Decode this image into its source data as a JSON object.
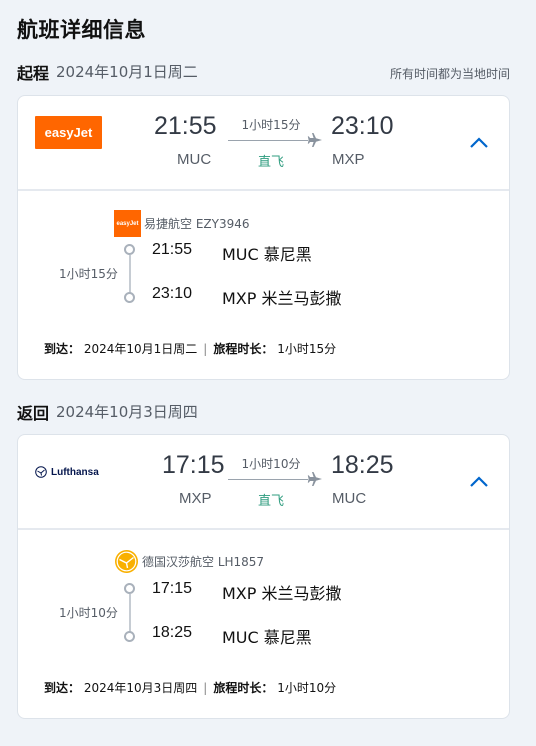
{
  "page_title": "航班详细信息",
  "outbound": {
    "kind": "起程",
    "date": "2024年10月1日周二",
    "timezone_note": "所有时间都为当地时间",
    "logo_text": "easyJet",
    "dep_time": "21:55",
    "arr_time": "23:10",
    "dep_code": "MUC",
    "arr_code": "MXP",
    "duration": "1小时15分",
    "direct": "直飞",
    "airline_flight": "易捷航空 EZY3946",
    "mini_logo": "easyJet",
    "tl_duration": "1小时15分",
    "tl_dep_time": "21:55",
    "tl_dep_place": "MUC 慕尼黑",
    "tl_arr_time": "23:10",
    "tl_arr_place": "MXP 米兰马彭撒",
    "arrive_label": "到达：",
    "arrive_date": "2024年10月1日周二",
    "total_label": "旅程时长：",
    "total_duration": "1小时15分"
  },
  "return": {
    "kind": "返回",
    "date": "2024年10月3日周四",
    "logo_text": "Lufthansa",
    "dep_time": "17:15",
    "arr_time": "18:25",
    "dep_code": "MXP",
    "arr_code": "MUC",
    "duration": "1小时10分",
    "direct": "直飞",
    "airline_flight": "德国汉莎航空 LH1857",
    "tl_duration": "1小时10分",
    "tl_dep_time": "17:15",
    "tl_dep_place": "MXP 米兰马彭撒",
    "tl_arr_time": "18:25",
    "tl_arr_place": "MUC 慕尼黑",
    "arrive_label": "到达：",
    "arrive_date": "2024年10月3日周四",
    "total_label": "旅程时长：",
    "total_duration": "1小时10分"
  },
  "separator": "|",
  "colors": {
    "accent": "#0066cc",
    "direct": "#2f9c7f",
    "easyjet": "#ff6600",
    "lufthansa_yellow": "#f9b000"
  }
}
